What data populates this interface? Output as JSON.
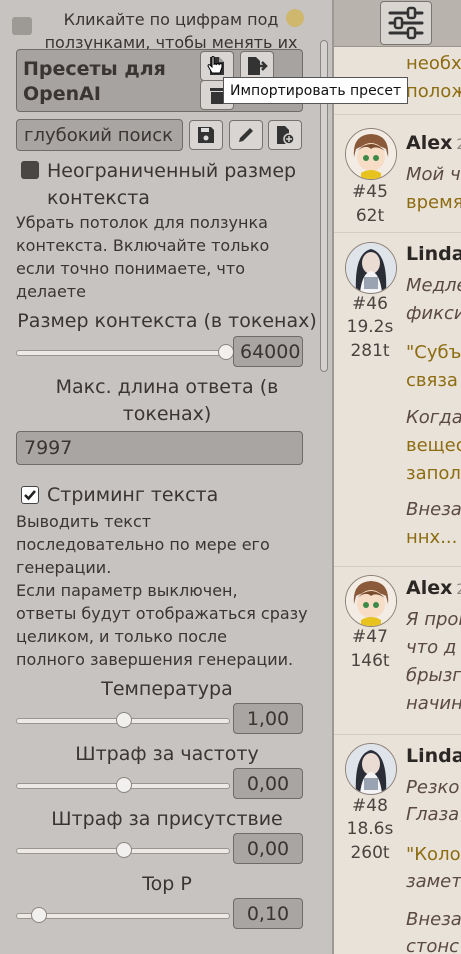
{
  "panel": {
    "hint": "Кликайте по цифрам под ползунками, чтобы менять их вручную.",
    "presets_title": "Пресеты для OpenAI",
    "preset_select_value": "глубокий поиск",
    "unlimited_context_label": "Неограниченный размер контекста",
    "unlimited_context_checked": false,
    "unlimited_context_desc": [
      "Убрать потолок для ползунка",
      "контекста. Включайте только",
      "если точно понимаете, что",
      "делаете"
    ],
    "context_size_label": "Размер контекста (в токенах)",
    "context_size_value": "64000",
    "context_size_fraction": 1.0,
    "max_response_label": "Макс. длина ответа (в токенах)",
    "max_response_value": "7997",
    "streaming_label": "Стриминг текста",
    "streaming_checked": true,
    "streaming_desc": [
      "Выводить текст",
      "последовательно по мере его",
      "генерации.",
      "Если параметр выключен,",
      "ответы будут отображаться сразу",
      "целиком, и только после",
      "полного завершения генерации."
    ],
    "sliders": [
      {
        "label": "Температура",
        "value": "1,00",
        "fraction": 0.5
      },
      {
        "label": "Штраф за частоту",
        "value": "0,00",
        "fraction": 0.5
      },
      {
        "label": "Штраф за присутствие",
        "value": "0,00",
        "fraction": 0.5
      },
      {
        "label": "Top P",
        "value": "0,10",
        "fraction": 0.1
      }
    ]
  },
  "tooltip": "Импортировать пресет",
  "chat": {
    "top_lines": [
      "необх",
      "полож"
    ],
    "messages": [
      {
        "name": "Alex",
        "time": "2",
        "index": "#45",
        "stats": [
          "62t"
        ],
        "avatar": "alex",
        "lines": [
          {
            "text": "Мой ч",
            "style": "ital"
          },
          {
            "text": "время",
            "style": "gold"
          }
        ]
      },
      {
        "name": "Linda",
        "time": "",
        "index": "#46",
        "stats": [
          "19.2s",
          "281t"
        ],
        "avatar": "linda",
        "lines": [
          {
            "text": "Медле",
            "style": "ital"
          },
          {
            "text": "фикси",
            "style": "ital"
          },
          {
            "text": "\"Субъ",
            "style": "gold"
          },
          {
            "text": "связа",
            "style": "gold"
          },
          {
            "text": "Когда",
            "style": "ital"
          },
          {
            "text": "вещес",
            "style": "gold"
          },
          {
            "text": "запол",
            "style": "gold"
          },
          {
            "text": "Внеза",
            "style": "ital"
          },
          {
            "text": "ннх...",
            "style": "gold"
          }
        ]
      },
      {
        "name": "Alex",
        "time": "2",
        "index": "#47",
        "stats": [
          "146t"
        ],
        "avatar": "alex",
        "lines": [
          {
            "text": "Я прог",
            "style": "ital"
          },
          {
            "text": "что д",
            "style": "ital"
          },
          {
            "text": "брызг",
            "style": "ital"
          },
          {
            "text": "начин",
            "style": "ital"
          }
        ]
      },
      {
        "name": "Linda",
        "time": "",
        "index": "#48",
        "stats": [
          "18.6s",
          "260t"
        ],
        "avatar": "linda",
        "lines": [
          {
            "text": "Резко",
            "style": "ital"
          },
          {
            "text": "Глаза",
            "style": "ital"
          },
          {
            "text": "\"Коло",
            "style": "gold"
          },
          {
            "text": "замет",
            "style": "ital"
          },
          {
            "text": "Внеза",
            "style": "ital"
          },
          {
            "text": "стонс",
            "style": "ital"
          }
        ]
      }
    ]
  }
}
